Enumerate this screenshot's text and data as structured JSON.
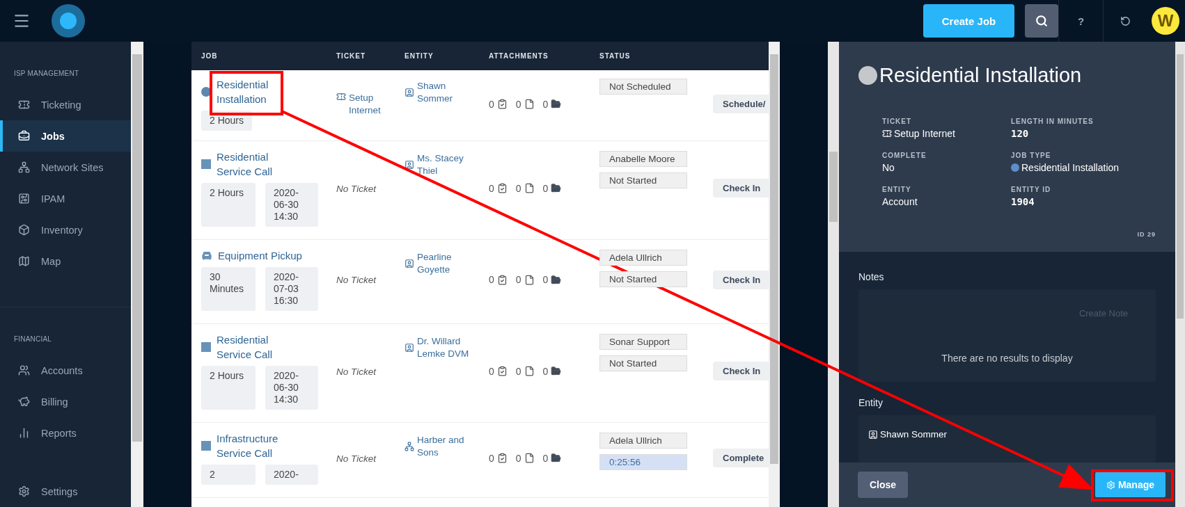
{
  "topbar": {
    "create_button": "Create Job",
    "help": "?",
    "avatar": "W"
  },
  "sidebar": {
    "sections": [
      {
        "title": "ISP MANAGEMENT",
        "items": [
          {
            "label": "Ticketing",
            "selected": false
          },
          {
            "label": "Jobs",
            "selected": true
          },
          {
            "label": "Network Sites",
            "selected": false
          },
          {
            "label": "IPAM",
            "selected": false
          },
          {
            "label": "Inventory",
            "selected": false
          },
          {
            "label": "Map",
            "selected": false
          }
        ]
      },
      {
        "title": "FINANCIAL",
        "items": [
          {
            "label": "Accounts",
            "selected": false
          },
          {
            "label": "Billing",
            "selected": false
          },
          {
            "label": "Reports",
            "selected": false
          }
        ]
      }
    ],
    "footer_item": {
      "label": "Settings",
      "selected": false
    }
  },
  "jobs_table": {
    "columns": [
      "JOB",
      "TICKET",
      "ENTITY",
      "ATTACHMENTS",
      "STATUS"
    ],
    "rows": [
      {
        "job": "Residential Installation",
        "kind": "circle",
        "chips": [
          "2 Hours"
        ],
        "ticket": {
          "text": "Setup Internet",
          "linked": true
        },
        "entity": {
          "text": "Shawn Sommer",
          "kind": "person"
        },
        "attachments": [
          "0",
          "0",
          "0"
        ],
        "status": [
          {
            "text": "Not Scheduled",
            "kind": "plain"
          }
        ],
        "action": "Schedule/"
      },
      {
        "job": "Residential Service Call",
        "kind": "square",
        "chips": [
          "2 Hours",
          "2020-06-30 14:30"
        ],
        "ticket": {
          "text": "No Ticket",
          "linked": false
        },
        "entity": {
          "text": "Ms. Stacey Thiel",
          "kind": "person"
        },
        "attachments": [
          "0",
          "0",
          "0"
        ],
        "status": [
          {
            "text": "Anabelle Moore",
            "kind": "plain"
          },
          {
            "text": "Not Started",
            "kind": "plain"
          }
        ],
        "action": "Check In"
      },
      {
        "job": "Equipment Pickup",
        "kind": "seat",
        "chips": [
          "30 Minutes",
          "2020-07-03 16:30"
        ],
        "ticket": {
          "text": "No Ticket",
          "linked": false
        },
        "entity": {
          "text": "Pearline Goyette",
          "kind": "person"
        },
        "attachments": [
          "0",
          "0",
          "0"
        ],
        "status": [
          {
            "text": "Adela Ullrich",
            "kind": "plain"
          },
          {
            "text": "Not Started",
            "kind": "plain"
          }
        ],
        "action": "Check In"
      },
      {
        "job": "Residential Service Call",
        "kind": "square",
        "chips": [
          "2 Hours",
          "2020-06-30 14:30"
        ],
        "ticket": {
          "text": "No Ticket",
          "linked": false
        },
        "entity": {
          "text": "Dr. Willard Lemke DVM",
          "kind": "person"
        },
        "attachments": [
          "0",
          "0",
          "0"
        ],
        "status": [
          {
            "text": "Sonar Support",
            "kind": "plain"
          },
          {
            "text": "Not Started",
            "kind": "plain"
          }
        ],
        "action": "Check In"
      },
      {
        "job": "Infrastructure Service Call",
        "kind": "square",
        "chips": [
          "2",
          "2020-"
        ],
        "ticket": {
          "text": "No Ticket",
          "linked": false
        },
        "entity": {
          "text": "Harber and Sons",
          "kind": "network"
        },
        "attachments": [
          "0",
          "0",
          "0"
        ],
        "status": [
          {
            "text": "Adela Ullrich",
            "kind": "plain"
          },
          {
            "text": "0:25:56",
            "kind": "timer"
          }
        ],
        "action": "Complete"
      }
    ]
  },
  "detail_panel": {
    "title": "Residential Installation",
    "fields": [
      {
        "label": "TICKET",
        "value": "Setup Internet",
        "kind": "ticket"
      },
      {
        "label": "LENGTH IN MINUTES",
        "value": "120",
        "kind": "mono"
      },
      {
        "label": "COMPLETE",
        "value": "No",
        "kind": "text"
      },
      {
        "label": "JOB TYPE",
        "value": "Residential Installation",
        "kind": "type"
      },
      {
        "label": "ENTITY",
        "value": "Account",
        "kind": "text"
      },
      {
        "label": "ENTITY ID",
        "value": "1904",
        "kind": "mono"
      }
    ],
    "id": "ID 29",
    "notes": {
      "title": "Notes",
      "create_button": {
        "label": "Create Note",
        "disabled": true
      },
      "empty": "There are no results to display"
    },
    "entity": {
      "title": "Entity",
      "name": "Shawn Sommer"
    },
    "close_button": "Close",
    "manage_button": "Manage"
  }
}
